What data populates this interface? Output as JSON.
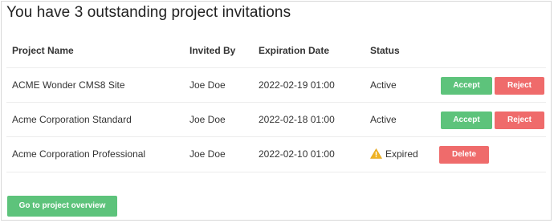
{
  "page": {
    "title": "You have 3 outstanding project invitations"
  },
  "table": {
    "headers": {
      "project_name": "Project Name",
      "invited_by": "Invited By",
      "expiration_date": "Expiration Date",
      "status": "Status"
    },
    "rows": [
      {
        "project_name": "ACME Wonder CMS8 Site",
        "invited_by": "Joe Doe",
        "expiration_date": "2022-02-19 01:00",
        "status": "Active",
        "actions": {
          "accept": "Accept",
          "reject": "Reject"
        }
      },
      {
        "project_name": "Acme Corporation Standard",
        "invited_by": "Joe Doe",
        "expiration_date": "2022-02-18 01:00",
        "status": "Active",
        "actions": {
          "accept": "Accept",
          "reject": "Reject"
        }
      },
      {
        "project_name": "Acme Corporation Professional",
        "invited_by": "Joe Doe",
        "expiration_date": "2022-02-10 01:00",
        "status": "Expired",
        "status_icon": "warning-icon",
        "actions": {
          "delete": "Delete"
        }
      }
    ]
  },
  "footer": {
    "overview_button": "Go to project overview"
  },
  "colors": {
    "accept": "#5dc37b",
    "reject": "#ef6b6b",
    "warning": "#f0b323"
  }
}
